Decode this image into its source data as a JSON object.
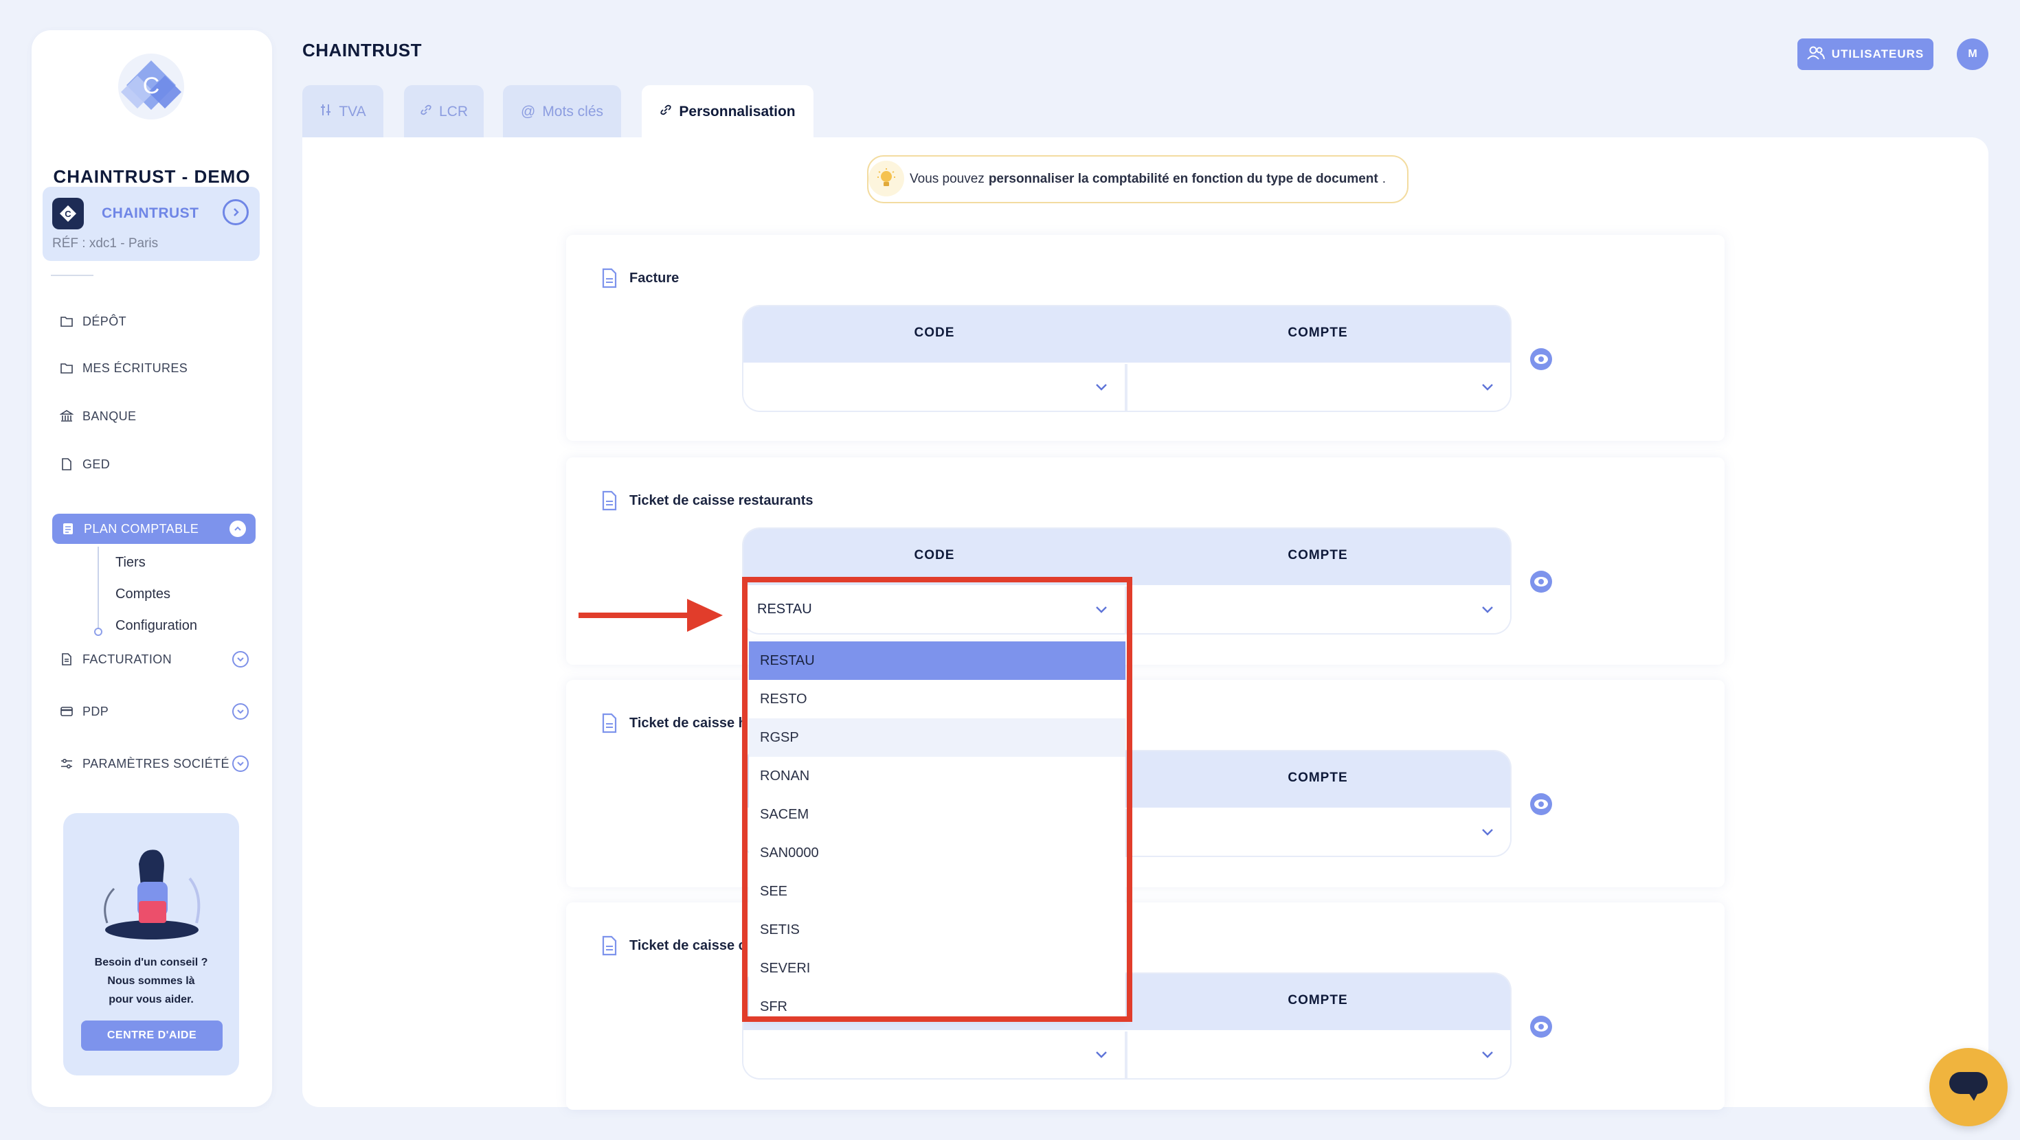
{
  "sidebar": {
    "brand": "CHAINTRUST - DEMO",
    "company": {
      "name": "CHAINTRUST",
      "ref": "RÉF : xdc1 - Paris"
    },
    "nav": {
      "depot": "DÉPÔT",
      "ecritures": "MES ÉCRITURES",
      "banque": "BANQUE",
      "ged": "GED",
      "plan": "PLAN COMPTABLE",
      "facturation": "FACTURATION",
      "pdp": "PDP",
      "parametres": "PARAMÈTRES SOCIÉTÉ"
    },
    "subnav": {
      "tiers": "Tiers",
      "comptes": "Comptes",
      "configuration": "Configuration"
    },
    "help": {
      "line1": "Besoin d'un conseil ?",
      "line2": "Nous sommes là",
      "line3": "pour vous aider.",
      "button": "CENTRE D'AIDE"
    }
  },
  "header": {
    "title": "CHAINTRUST",
    "users_button": "UTILISATEURS",
    "avatar_initial": "M"
  },
  "tabs": {
    "tva": "TVA",
    "lcr": "LCR",
    "mots": "Mots clés",
    "perso": "Personnalisation"
  },
  "info": {
    "prefix": "Vous pouvez",
    "bold": "personnaliser la comptabilité en fonction du type de document",
    "suffix": "."
  },
  "columns": {
    "code": "CODE",
    "compte": "COMPTE"
  },
  "cards": [
    {
      "title": "Facture",
      "code_value": ""
    },
    {
      "title": "Ticket de caisse restaurants",
      "code_value": "RESTAU"
    },
    {
      "title": "Ticket de caisse h"
    },
    {
      "title": "Ticket de caisse c"
    }
  ],
  "dropdown": {
    "options": [
      "RESTAU",
      "RESTO",
      "RGSP",
      "RONAN",
      "SACEM",
      "SAN0000",
      "SEE",
      "SETIS",
      "SEVERI",
      "SFR"
    ],
    "selected": "RESTAU",
    "hovered": "RGSP"
  },
  "colors": {
    "accent": "#7d93ec",
    "highlight": "#e13d2b",
    "chat": "#f0b43e"
  }
}
